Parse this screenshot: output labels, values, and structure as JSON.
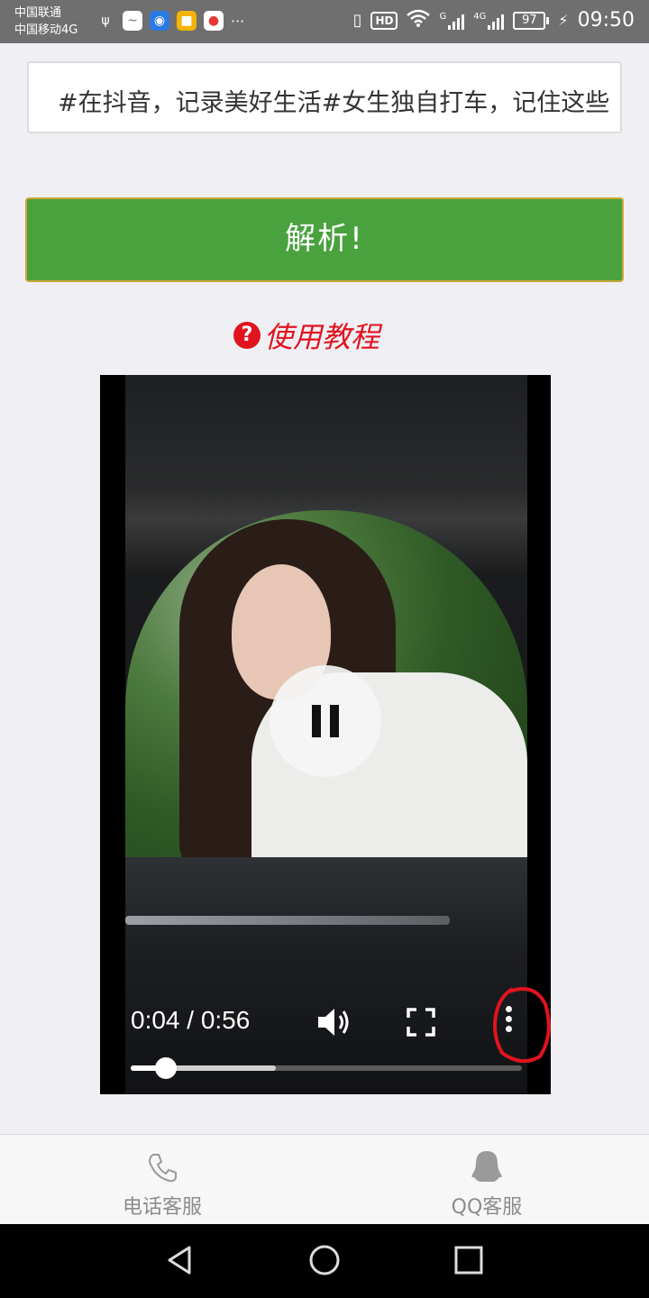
{
  "status_bar": {
    "carrier_1": "中国联通",
    "carrier_2": "中国移动4G",
    "net_hd": "HD",
    "sig1_label": "G",
    "sig2_label": "4G",
    "battery": "97",
    "time": "09:50",
    "more": "···"
  },
  "input": {
    "value": "#在抖音，记录美好生活#女生独自打车，记住这些"
  },
  "parse_button": {
    "label": "解析!"
  },
  "tutorial": {
    "icon_text": "?",
    "label": "使用教程"
  },
  "player": {
    "time_display": "0:04 / 0:56",
    "progress": {
      "played_fraction": 0.09,
      "buffered_fraction": 0.37
    },
    "state": "playing",
    "annotation_color": "#e0141e"
  },
  "bottom_bar": {
    "items": [
      {
        "label": "电话客服",
        "icon": "phone-icon"
      },
      {
        "label": "QQ客服",
        "icon": "qq-icon"
      }
    ]
  },
  "nav": {
    "buttons": [
      "back",
      "home",
      "recents"
    ]
  },
  "colors": {
    "accent_green": "#4aa23e",
    "link_red": "#e0141e"
  }
}
